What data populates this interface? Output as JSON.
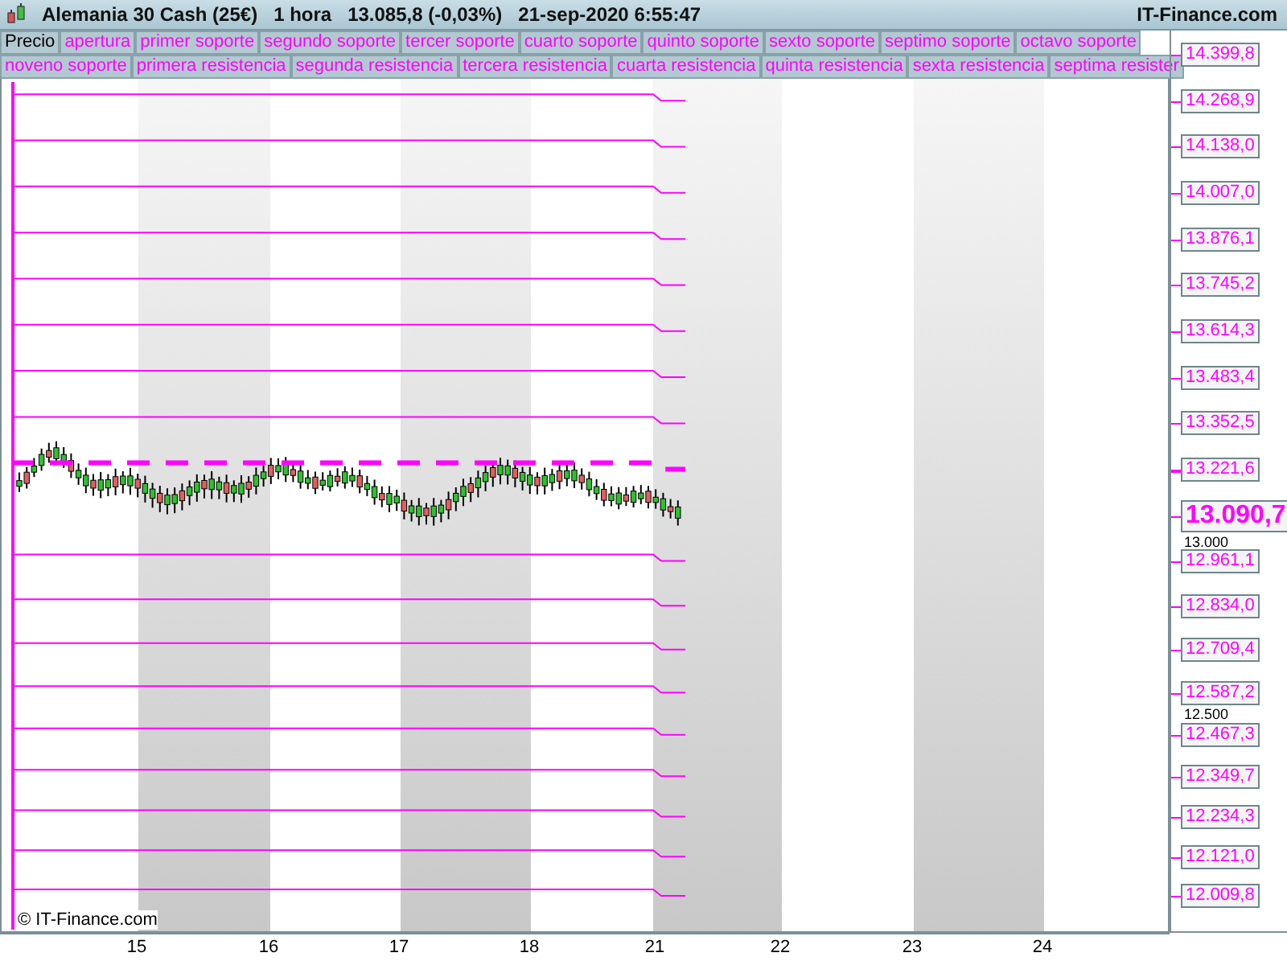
{
  "header": {
    "title": "Alemania 30 Cash (25€)",
    "timeframe": "1 hora",
    "price": "13.085,8 (-0,03%)",
    "datetime": "21-sep-2020 6:55:47",
    "brand": "IT-Finance.com"
  },
  "legend_rows": [
    [
      {
        "label": "Precio",
        "color": "#000000"
      },
      {
        "label": "apertura",
        "color": "#ff00ff"
      },
      {
        "label": "primer soporte",
        "color": "#ff00ff"
      },
      {
        "label": "segundo soporte",
        "color": "#ff00ff"
      },
      {
        "label": "tercer soporte",
        "color": "#ff00ff"
      },
      {
        "label": "cuarto soporte",
        "color": "#ff00ff"
      },
      {
        "label": "quinto soporte",
        "color": "#ff00ff"
      },
      {
        "label": "sexto soporte",
        "color": "#ff00ff"
      },
      {
        "label": "septimo soporte",
        "color": "#ff00ff"
      },
      {
        "label": "octavo soporte",
        "color": "#ff00ff"
      }
    ],
    [
      {
        "label": "noveno soporte",
        "color": "#ff00ff"
      },
      {
        "label": "primera resistencia",
        "color": "#ff00ff"
      },
      {
        "label": "segunda resistencia",
        "color": "#ff00ff"
      },
      {
        "label": "tercera resistencia",
        "color": "#ff00ff"
      },
      {
        "label": "cuarta resistencia",
        "color": "#ff00ff"
      },
      {
        "label": "quinta resistencia",
        "color": "#ff00ff"
      },
      {
        "label": "sexta resistencia",
        "color": "#ff00ff"
      },
      {
        "label": "septima resister",
        "color": "#ff00ff"
      }
    ]
  ],
  "price_axis": {
    "levels": [
      {
        "value": "14.399,8",
        "kind": "solid"
      },
      {
        "value": "14.268,9",
        "kind": "solid"
      },
      {
        "value": "14.138,0",
        "kind": "solid"
      },
      {
        "value": "14.007,0",
        "kind": "solid"
      },
      {
        "value": "13.876,1",
        "kind": "solid"
      },
      {
        "value": "13.745,2",
        "kind": "solid"
      },
      {
        "value": "13.614,3",
        "kind": "solid"
      },
      {
        "value": "13.483,4",
        "kind": "solid"
      },
      {
        "value": "13.352,5",
        "kind": "solid"
      },
      {
        "value": "13.221,6",
        "kind": "dashed"
      },
      {
        "value": "12.961,1",
        "kind": "solid"
      },
      {
        "value": "12.834,0",
        "kind": "solid"
      },
      {
        "value": "12.709,4",
        "kind": "solid"
      },
      {
        "value": "12.587,2",
        "kind": "solid"
      },
      {
        "value": "12.467,3",
        "kind": "solid"
      },
      {
        "value": "12.349,7",
        "kind": "solid"
      },
      {
        "value": "12.234,3",
        "kind": "solid"
      },
      {
        "value": "12.121,0",
        "kind": "solid"
      },
      {
        "value": "12.009,8",
        "kind": "solid"
      }
    ],
    "ticks": [
      "13.000",
      "12.500"
    ],
    "current_price": "13.090,7"
  },
  "time_axis": {
    "labels": [
      "15",
      "16",
      "17",
      "18",
      "21",
      "22",
      "23",
      "24"
    ]
  },
  "copyright": "© IT-Finance.com"
}
